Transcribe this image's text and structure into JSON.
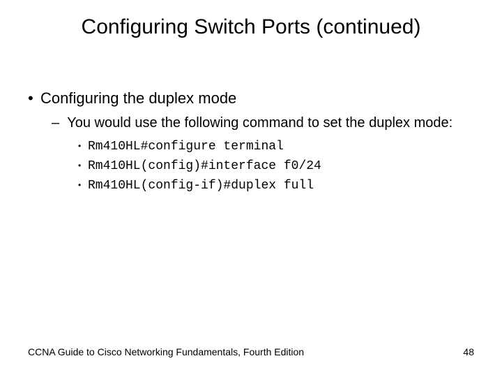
{
  "title": "Configuring Switch Ports (continued)",
  "lvl1": "Configuring the duplex mode",
  "lvl2": "You would use the following command to set the duplex mode:",
  "cmd1": "Rm410HL#configure terminal",
  "cmd2": "Rm410HL(config)#interface f0/24",
  "cmd3": "Rm410HL(config-if)#duplex full",
  "footer_left": "CCNA Guide to Cisco Networking Fundamentals, Fourth Edition",
  "footer_right": "48"
}
